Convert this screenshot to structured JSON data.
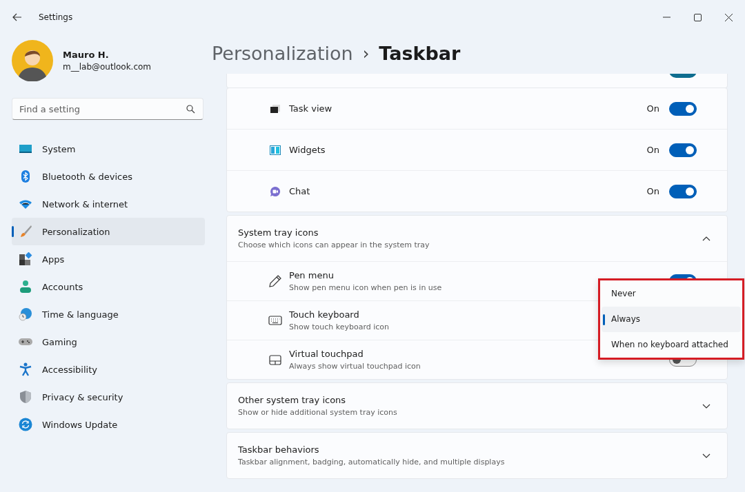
{
  "window": {
    "title": "Settings"
  },
  "user": {
    "name": "Mauro H.",
    "email": "m__lab@outlook.com"
  },
  "search": {
    "placeholder": "Find a setting"
  },
  "sidebar": {
    "items": [
      {
        "label": "System",
        "kind": "system",
        "selected": false
      },
      {
        "label": "Bluetooth & devices",
        "kind": "bluetooth",
        "selected": false
      },
      {
        "label": "Network & internet",
        "kind": "network",
        "selected": false
      },
      {
        "label": "Personalization",
        "kind": "brush",
        "selected": true
      },
      {
        "label": "Apps",
        "kind": "apps",
        "selected": false
      },
      {
        "label": "Accounts",
        "kind": "accounts",
        "selected": false
      },
      {
        "label": "Time & language",
        "kind": "time",
        "selected": false
      },
      {
        "label": "Gaming",
        "kind": "gaming",
        "selected": false
      },
      {
        "label": "Accessibility",
        "kind": "accessibility",
        "selected": false
      },
      {
        "label": "Privacy & security",
        "kind": "privacy",
        "selected": false
      },
      {
        "label": "Windows Update",
        "kind": "update",
        "selected": false
      }
    ]
  },
  "breadcrumb": {
    "parent": "Personalization",
    "separator": "›",
    "current": "Taskbar"
  },
  "clipped_row": {
    "on": true
  },
  "taskbar_items": [
    {
      "label": "Task view",
      "kind": "taskview",
      "state": "On",
      "on": true
    },
    {
      "label": "Widgets",
      "kind": "widgets",
      "state": "On",
      "on": true
    },
    {
      "label": "Chat",
      "kind": "chat",
      "state": "On",
      "on": true
    }
  ],
  "system_tray": {
    "title": "System tray icons",
    "description": "Choose which icons can appear in the system tray",
    "expanded": true,
    "items": [
      {
        "label": "Pen menu",
        "description": "Show pen menu icon when pen is in use",
        "kind": "pen",
        "on": true
      },
      {
        "label": "Touch keyboard",
        "description": "Show touch keyboard icon",
        "kind": "keyboard"
      },
      {
        "label": "Virtual touchpad",
        "description": "Always show virtual touchpad icon",
        "kind": "touchpad",
        "on": false
      }
    ]
  },
  "dropdown": {
    "options": [
      {
        "label": "Never",
        "selected": false
      },
      {
        "label": "Always",
        "selected": true
      },
      {
        "label": "When no keyboard attached",
        "selected": false
      }
    ]
  },
  "sections": [
    {
      "title": "Other system tray icons",
      "description": "Show or hide additional system tray icons",
      "expanded": false
    },
    {
      "title": "Taskbar behaviors",
      "description": "Taskbar alignment, badging, automatically hide, and multiple displays",
      "expanded": false
    }
  ]
}
